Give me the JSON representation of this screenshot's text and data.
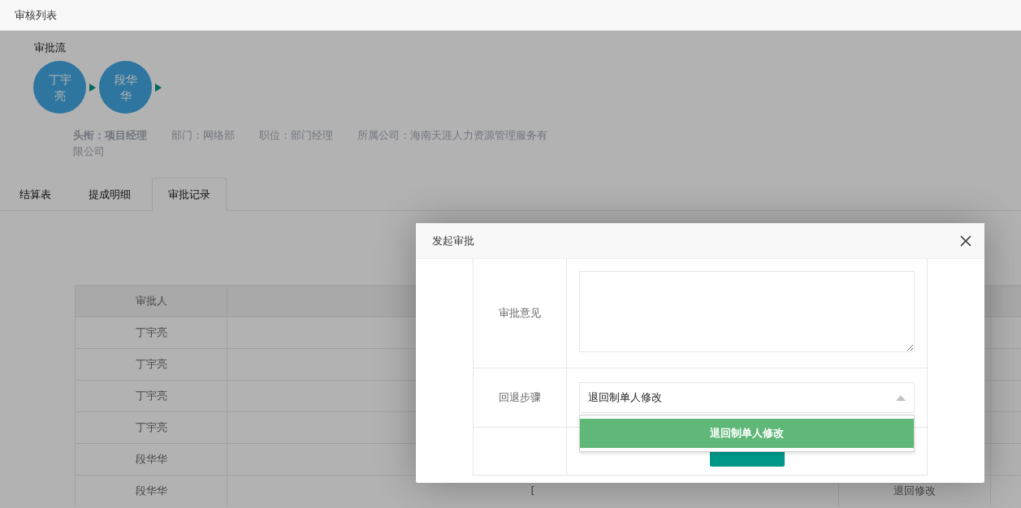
{
  "header": {
    "title": "审核列表"
  },
  "approval_flow": {
    "title": "审批流",
    "steps": [
      {
        "name": "丁宇亮"
      },
      {
        "name": "段华华"
      }
    ]
  },
  "info": [
    {
      "text": "头衔：项目经理",
      "bold": true
    },
    {
      "text": "部门：网络部",
      "bold": false
    },
    {
      "text": "职位：部门经理",
      "bold": false
    },
    {
      "text": "所属公司：海南天涯人力资源管理服务有限公司",
      "bold": false
    }
  ],
  "tabs": [
    {
      "label": "结算表",
      "selected": false
    },
    {
      "label": "提成明细",
      "selected": false
    },
    {
      "label": "审批记录",
      "selected": true
    }
  ],
  "table": {
    "columns": [
      "审批人"
    ],
    "rows": [
      {
        "cells": [
          "丁宇亮"
        ]
      },
      {
        "cells": [
          "丁宇亮"
        ]
      },
      {
        "cells": [
          "丁宇亮"
        ]
      },
      {
        "cells": [
          "丁宇亮"
        ]
      },
      {
        "cells": [
          "段华华"
        ]
      },
      {
        "cells": [
          "段华华",
          "[",
          "退回修改"
        ]
      }
    ]
  },
  "dialog": {
    "title": "发起审批",
    "fields": [
      {
        "kind": "textarea",
        "label": "审批意见"
      },
      {
        "kind": "select",
        "label": "回退步骤",
        "value": "退回制单人修改",
        "expanded": true,
        "options": [
          {
            "label": "退回制单人修改",
            "selected": true
          }
        ]
      }
    ]
  }
}
